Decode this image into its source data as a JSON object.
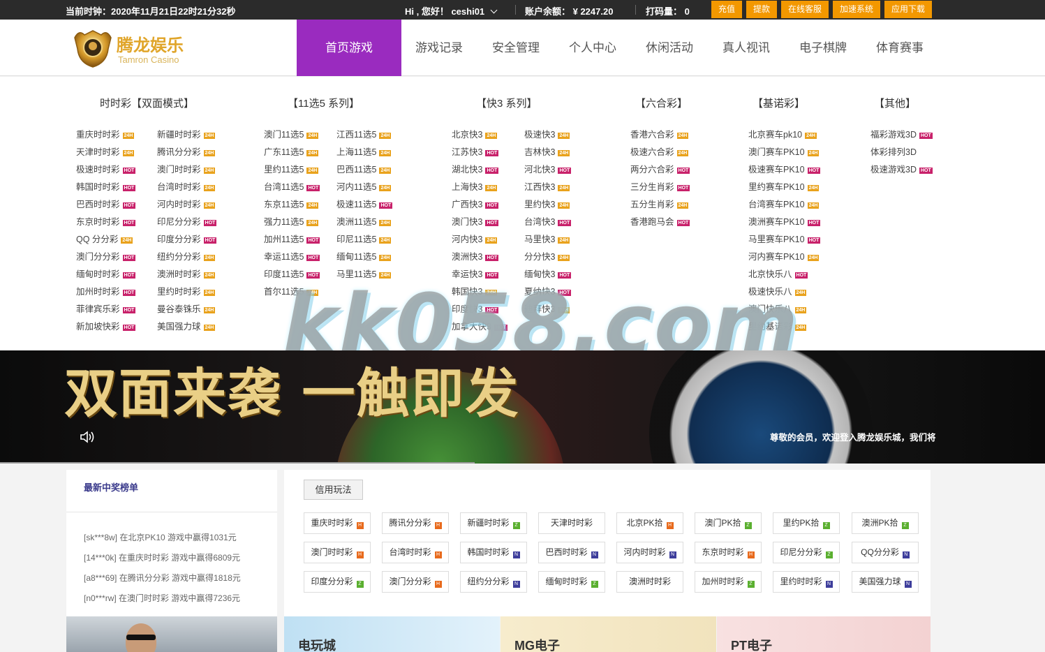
{
  "topbar": {
    "clock_label": "当前时钟：2020年11月21日22时21分32秒",
    "greeting": "Hi , 您好！ ceshi01",
    "balance": "账户余额：  ¥  2247.20",
    "code": "打码量：  0",
    "buttons": [
      "充值",
      "提款",
      "在线客服",
      "加速系统",
      "应用下载"
    ],
    "button_color": "#f39800"
  },
  "header": {
    "logo_text": "腾龙娱乐",
    "logo_sub": "Tamron Casino",
    "nav": [
      "首页游戏",
      "游戏记录",
      "安全管理",
      "个人中心",
      "休闲活动",
      "真人视讯",
      "电子棋牌",
      "体育赛事"
    ],
    "active_color": "#9a2bbf"
  },
  "menu": {
    "columns": [
      {
        "title": "时时彩【双面模式】",
        "items": [
          {
            "name": "重庆时时彩",
            "tag": "24H"
          },
          {
            "name": "新疆时时彩",
            "tag": "24H"
          },
          {
            "name": "天津时时彩",
            "tag": "24H"
          },
          {
            "name": "腾讯分分彩",
            "tag": "24H"
          },
          {
            "name": "极速时时彩",
            "tag": "HOT"
          },
          {
            "name": "澳门时时彩",
            "tag": "24H"
          },
          {
            "name": "韩国时时彩",
            "tag": "HOT"
          },
          {
            "name": "台湾时时彩",
            "tag": "24H"
          },
          {
            "name": "巴西时时彩",
            "tag": "HOT"
          },
          {
            "name": "河内时时彩",
            "tag": "24H"
          },
          {
            "name": "东京时时彩",
            "tag": "HOT"
          },
          {
            "name": "印尼分分彩",
            "tag": "HOT"
          },
          {
            "name": "QQ 分分彩",
            "tag": "24H"
          },
          {
            "name": "印度分分彩",
            "tag": "HOT"
          },
          {
            "name": "澳门分分彩",
            "tag": "HOT"
          },
          {
            "name": "纽约分分彩",
            "tag": "24H"
          },
          {
            "name": "缅甸时时彩",
            "tag": "HOT"
          },
          {
            "name": "澳洲时时彩",
            "tag": "24H"
          },
          {
            "name": "加州时时彩",
            "tag": "HOT"
          },
          {
            "name": "里约时时彩",
            "tag": "24H"
          },
          {
            "name": "菲律宾乐彩",
            "tag": "HOT"
          },
          {
            "name": "曼谷泰铢乐",
            "tag": "24H"
          },
          {
            "name": "新加坡快彩",
            "tag": "HOT"
          },
          {
            "name": "美国强力球",
            "tag": "24H"
          }
        ]
      },
      {
        "title": "【11选5 系列】",
        "items": [
          {
            "name": "澳门11选5",
            "tag": "24H"
          },
          {
            "name": "江西11选5",
            "tag": "24H"
          },
          {
            "name": "广东11选5",
            "tag": "24H"
          },
          {
            "name": "上海11选5",
            "tag": "24H"
          },
          {
            "name": "里约11选5",
            "tag": "24H"
          },
          {
            "name": "巴西11选5",
            "tag": "24H"
          },
          {
            "name": "台湾11选5",
            "tag": "HOT"
          },
          {
            "name": "河内11选5",
            "tag": "24H"
          },
          {
            "name": "东京11选5",
            "tag": "24H"
          },
          {
            "name": "极速11选5",
            "tag": "HOT"
          },
          {
            "name": "强力11选5",
            "tag": "24H"
          },
          {
            "name": "澳洲11选5",
            "tag": "24H"
          },
          {
            "name": "加州11选5",
            "tag": "HOT"
          },
          {
            "name": "印尼11选5",
            "tag": "24H"
          },
          {
            "name": "幸运11选5",
            "tag": "HOT"
          },
          {
            "name": "缅甸11选5",
            "tag": "24H"
          },
          {
            "name": "印度11选5",
            "tag": "HOT"
          },
          {
            "name": "马里11选5",
            "tag": "24H"
          },
          {
            "name": "首尔11选5",
            "tag": "24H"
          }
        ]
      },
      {
        "title": "【快3 系列】",
        "items": [
          {
            "name": "北京快3",
            "tag": "24H"
          },
          {
            "name": "极速快3",
            "tag": "24H"
          },
          {
            "name": "江苏快3",
            "tag": "HOT"
          },
          {
            "name": "吉林快3",
            "tag": "24H"
          },
          {
            "name": "湖北快3",
            "tag": "HOT"
          },
          {
            "name": "河北快3",
            "tag": "HOT"
          },
          {
            "name": "上海快3",
            "tag": "24H"
          },
          {
            "name": "江西快3",
            "tag": "24H"
          },
          {
            "name": "广西快3",
            "tag": "HOT"
          },
          {
            "name": "里约快3",
            "tag": "24H"
          },
          {
            "name": "澳门快3",
            "tag": "HOT"
          },
          {
            "name": "台湾快3",
            "tag": "HOT"
          },
          {
            "name": "河内快3",
            "tag": "24H"
          },
          {
            "name": "马里快3",
            "tag": "24H"
          },
          {
            "name": "澳洲快3",
            "tag": "HOT"
          },
          {
            "name": "分分快3",
            "tag": "24H"
          },
          {
            "name": "幸运快3",
            "tag": "HOT"
          },
          {
            "name": "缅甸快3",
            "tag": "HOT"
          },
          {
            "name": "韩国快3",
            "tag": "24H"
          },
          {
            "name": "夏纳快3",
            "tag": "HOT"
          },
          {
            "name": "印度快3",
            "tag": "HOT"
          },
          {
            "name": "迪拜快3",
            "tag": "24H"
          },
          {
            "name": "加拿大快3",
            "tag": "HOT"
          }
        ]
      },
      {
        "title": "【六合彩】",
        "items": [
          {
            "name": "香港六合彩",
            "tag": "24H"
          },
          {
            "name": "极速六合彩",
            "tag": "24H"
          },
          {
            "name": "两分六合彩",
            "tag": "HOT"
          },
          {
            "name": "三分生肖彩",
            "tag": "HOT"
          },
          {
            "name": "五分生肖彩",
            "tag": "24H"
          },
          {
            "name": "香港跑马会",
            "tag": "HOT"
          }
        ]
      },
      {
        "title": "【基诺彩】",
        "items": [
          {
            "name": "北京赛车pk10",
            "tag": "24H"
          },
          {
            "name": "澳门赛车PK10",
            "tag": "24H"
          },
          {
            "name": "极速赛车PK10",
            "tag": "HOT"
          },
          {
            "name": "里约赛车PK10",
            "tag": "24H"
          },
          {
            "name": "台湾赛车PK10",
            "tag": "24H"
          },
          {
            "name": "澳洲赛车PK10",
            "tag": "HOT"
          },
          {
            "name": "马里赛车PK10",
            "tag": "HOT"
          },
          {
            "name": "河内赛车PK10",
            "tag": "24H"
          },
          {
            "name": "北京快乐八",
            "tag": "HOT"
          },
          {
            "name": "极速快乐八",
            "tag": "24H"
          },
          {
            "name": "澳门快乐八",
            "tag": "24H"
          },
          {
            "name": "里约基诺彩",
            "tag": "24H"
          }
        ]
      },
      {
        "title": "【其他】",
        "items": [
          {
            "name": "福彩游戏3D",
            "tag": "HOT"
          },
          {
            "name": "体彩排列3D",
            "tag": ""
          },
          {
            "name": "极速游戏3D",
            "tag": "HOT"
          }
        ]
      }
    ],
    "badge_colors": {
      "24H": "#e9a21c",
      "HOT": "#c8216a"
    }
  },
  "watermark": "kk058.com",
  "banner": {
    "slogan": "双面来袭 一触即发",
    "notice": "尊敬的会员，欢迎登入腾龙娱乐城，我们将"
  },
  "winners": {
    "title": "最新中奖榜单",
    "rows": [
      "[sk***8w] 在北京PK10 游戏中赢得1031元",
      "[14***0k] 在重庆时时彩 游戏中赢得6809元",
      "[a8***69] 在腾讯分分彩 游戏中赢得1818元",
      "[n0***rw] 在澳门时时彩 游戏中赢得7236元"
    ]
  },
  "credit": {
    "tab": "信用玩法",
    "games": [
      {
        "name": "重庆时时彩",
        "tag": "H"
      },
      {
        "name": "腾讯分分彩",
        "tag": "H"
      },
      {
        "name": "新疆时时彩",
        "tag": "Z"
      },
      {
        "name": "天津时时彩",
        "tag": ""
      },
      {
        "name": "北京PK拾",
        "tag": "H"
      },
      {
        "name": "澳门PK拾",
        "tag": "Z"
      },
      {
        "name": "里约PK拾",
        "tag": "Z"
      },
      {
        "name": "澳洲PK拾",
        "tag": "Z"
      },
      {
        "name": "澳门时时彩",
        "tag": "H"
      },
      {
        "name": "台湾时时彩",
        "tag": "H"
      },
      {
        "name": "韩国时时彩",
        "tag": "N"
      },
      {
        "name": "巴西时时彩",
        "tag": "N"
      },
      {
        "name": "河内时时彩",
        "tag": "N"
      },
      {
        "name": "东京时时彩",
        "tag": "H"
      },
      {
        "name": "印尼分分彩",
        "tag": "Z"
      },
      {
        "name": "QQ分分彩",
        "tag": "N"
      },
      {
        "name": "印度分分彩",
        "tag": "Z"
      },
      {
        "name": "澳门分分彩",
        "tag": "H"
      },
      {
        "name": "纽约分分彩",
        "tag": "N"
      },
      {
        "name": "缅甸时时彩",
        "tag": "Z"
      },
      {
        "name": "澳洲时时彩",
        "tag": ""
      },
      {
        "name": "加州时时彩",
        "tag": "Z"
      },
      {
        "name": "里约时时彩",
        "tag": "N"
      },
      {
        "name": "美国强力球",
        "tag": "N"
      }
    ]
  },
  "cards": [
    {
      "name": "电玩城",
      "color": "#cfe6f4"
    },
    {
      "name": "MG电子",
      "color": "#f4e9c8"
    },
    {
      "name": "PT电子",
      "color": "#f6dede"
    }
  ]
}
